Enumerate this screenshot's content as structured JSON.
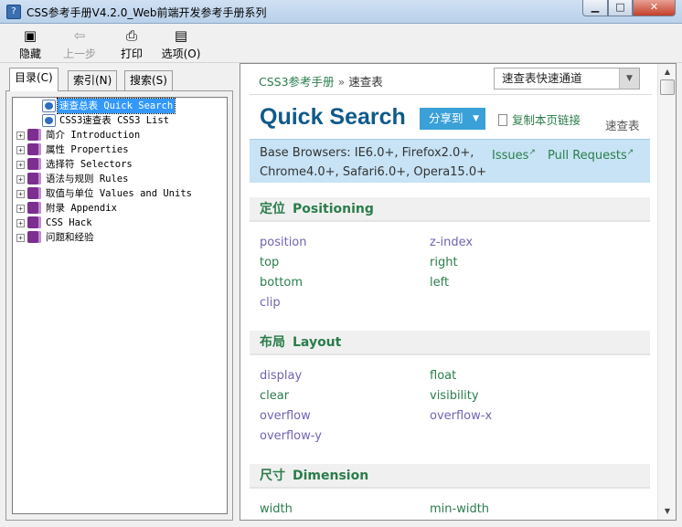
{
  "window": {
    "title": "CSS参考手册V4.2.0_Web前端开发参考手册系列",
    "min_label": "▁",
    "max_label": "□",
    "close_label": "✕"
  },
  "toolbar": {
    "hide_label": "隐藏",
    "back_label": "上一步",
    "print_label": "打印",
    "options_label": "选项(O)"
  },
  "tabs": [
    "目录(C)",
    "索引(N)",
    "搜索(S)"
  ],
  "tree": {
    "items": [
      {
        "label": "速查总表 Quick Search",
        "selected": true,
        "level": 1,
        "expander": false,
        "icon": "page-icon"
      },
      {
        "label": "CSS3速查表 CSS3 List",
        "selected": false,
        "level": 1,
        "expander": false,
        "icon": "page-icon"
      },
      {
        "label": "简介 Introduction",
        "selected": false,
        "level": 0,
        "expander": true,
        "icon": "book-icon"
      },
      {
        "label": "属性 Properties",
        "selected": false,
        "level": 0,
        "expander": true,
        "icon": "book-icon"
      },
      {
        "label": "选择符 Selectors",
        "selected": false,
        "level": 0,
        "expander": true,
        "icon": "book-icon"
      },
      {
        "label": "语法与规则 Rules",
        "selected": false,
        "level": 0,
        "expander": true,
        "icon": "book-icon"
      },
      {
        "label": "取值与单位 Values and Units",
        "selected": false,
        "level": 0,
        "expander": true,
        "icon": "book-icon"
      },
      {
        "label": "附录 Appendix",
        "selected": false,
        "level": 0,
        "expander": true,
        "icon": "book-icon"
      },
      {
        "label": "CSS Hack",
        "selected": false,
        "level": 0,
        "expander": true,
        "icon": "book-icon"
      },
      {
        "label": "问题和经验",
        "selected": false,
        "level": 0,
        "expander": true,
        "icon": "book-icon"
      }
    ]
  },
  "content": {
    "breadcrumb_root": "CSS3参考手册",
    "breadcrumb_sep": "»",
    "breadcrumb_current": "速查表",
    "quick_select_value": "速查表快速通道",
    "page_title": "Quick Search",
    "share_label": "分享到",
    "copy_link_label": "复制本页链接",
    "page_tag": "速查表",
    "browsers_line1": "Base Browsers: IE6.0+, Firefox2.0+,",
    "browsers_line2": "Chrome4.0+, Safari6.0+, Opera15.0+",
    "issues_label": "Issues",
    "pulls_label": "Pull Requests",
    "sections": [
      {
        "cn": "定位",
        "en": "Positioning",
        "props": [
          {
            "name": "position",
            "visited": true
          },
          {
            "name": "z-index",
            "visited": true
          },
          {
            "name": "top",
            "visited": false
          },
          {
            "name": "right",
            "visited": false
          },
          {
            "name": "bottom",
            "visited": false
          },
          {
            "name": "left",
            "visited": false
          },
          {
            "name": "clip",
            "visited": true
          }
        ]
      },
      {
        "cn": "布局",
        "en": "Layout",
        "props": [
          {
            "name": "display",
            "visited": true
          },
          {
            "name": "float",
            "visited": false
          },
          {
            "name": "clear",
            "visited": false
          },
          {
            "name": "visibility",
            "visited": false
          },
          {
            "name": "overflow",
            "visited": true
          },
          {
            "name": "overflow-x",
            "visited": true
          },
          {
            "name": "overflow-y",
            "visited": true
          }
        ]
      },
      {
        "cn": "尺寸",
        "en": "Dimension",
        "props": [
          {
            "name": "width",
            "visited": false
          },
          {
            "name": "min-width",
            "visited": false
          }
        ]
      }
    ]
  },
  "colors": {
    "link": "#2a7d4b",
    "visited_link": "#6f64b5",
    "title": "#0f5a8a",
    "share_button": "#3aa0d8",
    "browsers_bg": "#c7e3f5",
    "selection": "#3399ff"
  }
}
